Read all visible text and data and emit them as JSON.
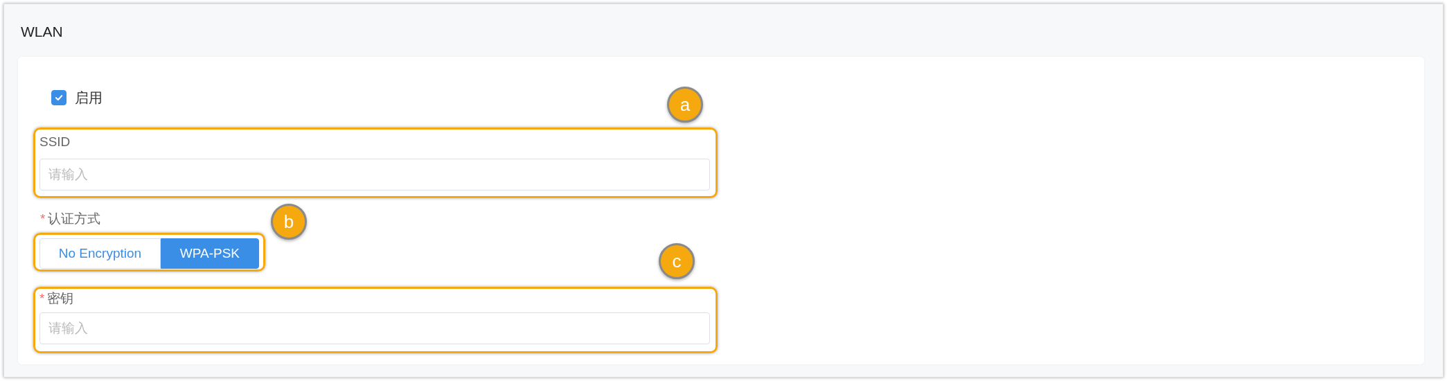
{
  "section_title": "WLAN",
  "enable": {
    "label": "启用",
    "checked": true
  },
  "ssid": {
    "label": "SSID",
    "placeholder": "请输入",
    "callout": "a"
  },
  "auth": {
    "label": "认证方式",
    "required_mark": "*",
    "callout": "b",
    "options": [
      {
        "label": "No Encryption",
        "selected": false
      },
      {
        "label": "WPA-PSK",
        "selected": true
      }
    ]
  },
  "key": {
    "label": "密钥",
    "required_mark": "*",
    "placeholder": "请输入",
    "callout": "c"
  }
}
